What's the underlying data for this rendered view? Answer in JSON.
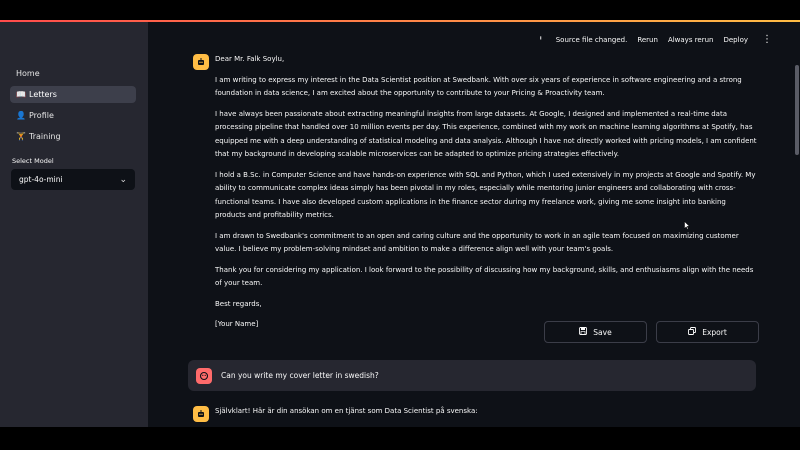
{
  "sidebar": {
    "nav": [
      {
        "icon": "📖",
        "label": "Letters",
        "active": true
      },
      {
        "icon": "👤",
        "label": "Profile",
        "active": false
      },
      {
        "icon": "🏋",
        "label": "Training",
        "active": false
      }
    ],
    "home_label": "Home",
    "select_label": "Select Model",
    "select_value": "gpt-4o-mini"
  },
  "toolbar": {
    "status": "Source file changed.",
    "rerun": "Rerun",
    "always_rerun": "Always rerun",
    "deploy": "Deploy"
  },
  "letter": {
    "greeting": "Dear Mr. Falk Soylu,",
    "p1": "I am writing to express my interest in the Data Scientist position at Swedbank. With over six years of experience in software engineering and a strong foundation in data science, I am excited about the opportunity to contribute to your Pricing & Proactivity team.",
    "p2": "I have always been passionate about extracting meaningful insights from large datasets. At Google, I designed and implemented a real-time data processing pipeline that handled over 10 million events per day. This experience, combined with my work on machine learning algorithms at Spotify, has equipped me with a deep understanding of statistical modeling and data analysis. Although I have not directly worked with pricing models, I am confident that my background in developing scalable microservices can be adapted to optimize pricing strategies effectively.",
    "p3": "I hold a B.Sc. in Computer Science and have hands-on experience with SQL and Python, which I used extensively in my projects at Google and Spotify. My ability to communicate complex ideas simply has been pivotal in my roles, especially while mentoring junior engineers and collaborating with cross-functional teams. I have also developed custom applications in the finance sector during my freelance work, giving me some insight into banking products and profitability metrics.",
    "p4": "I am drawn to Swedbank's commitment to an open and caring culture and the opportunity to work in an agile team focused on maximizing customer value. I believe my problem-solving mindset and ambition to make a difference align well with your team's goals.",
    "p5": "Thank you for considering my application. I look forward to the possibility of discussing how my background, skills, and enthusiasms align with the needs of your team.",
    "closing": "Best regards,",
    "signature": "[Your Name]"
  },
  "actions": {
    "save": "Save",
    "export": "Export"
  },
  "user_message": "Can you write my cover letter in swedish?",
  "reply_start": "Självklart! Här är din ansökan om en tjänst som Data Scientist på svenska:",
  "colors": {
    "accent_start": "#ff4b4b",
    "accent_end": "#ffbd45",
    "bot_avatar": "#ffbd45",
    "user_avatar": "#ff6b6b",
    "sidebar_bg": "#262730",
    "main_bg": "#0e1117"
  }
}
